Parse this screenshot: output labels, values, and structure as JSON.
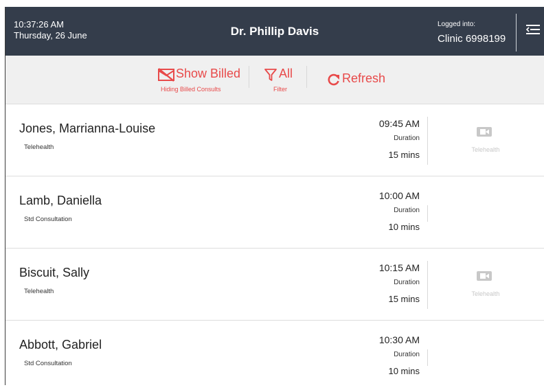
{
  "header": {
    "time": "10:37:26 AM",
    "date": "Thursday, 26 June",
    "doctor": "Dr. Phillip Davis",
    "logged_label": "Logged into:",
    "clinic": "Clinic 6998199",
    "menu_icon": "menu-collapse-icon"
  },
  "toolbar": {
    "show_billed": {
      "label": "Show Billed",
      "sub": "Hiding Billed Consults",
      "icon": "hide-billed-icon"
    },
    "filter": {
      "label": "All",
      "sub": "Filter",
      "icon": "filter-icon"
    },
    "refresh": {
      "label": "Refresh",
      "icon": "refresh-icon"
    }
  },
  "appointments": [
    {
      "name": "Jones, Marrianna-Louise",
      "type": "Telehealth",
      "time": "09:45 AM",
      "duration_label": "Duration",
      "duration": "15 mins",
      "telehealth_label": "Telehealth"
    },
    {
      "name": "Lamb, Daniella",
      "type": "Std Consultation",
      "time": "10:00 AM",
      "duration_label": "Duration",
      "duration": "10 mins"
    },
    {
      "name": "Biscuit, Sally",
      "type": "Telehealth",
      "time": "10:15 AM",
      "duration_label": "Duration",
      "duration": "15 mins",
      "telehealth_label": "Telehealth"
    },
    {
      "name": "Abbott, Gabriel",
      "type": "Std Consultation",
      "time": "10:30 AM",
      "duration_label": "Duration",
      "duration": "10 mins"
    }
  ],
  "colors": {
    "header_bg": "#343d4b",
    "accent_red": "#e84a4a",
    "toolbar_bg": "#f0f0f0",
    "telehealth_gray": "#c8c8c8"
  }
}
